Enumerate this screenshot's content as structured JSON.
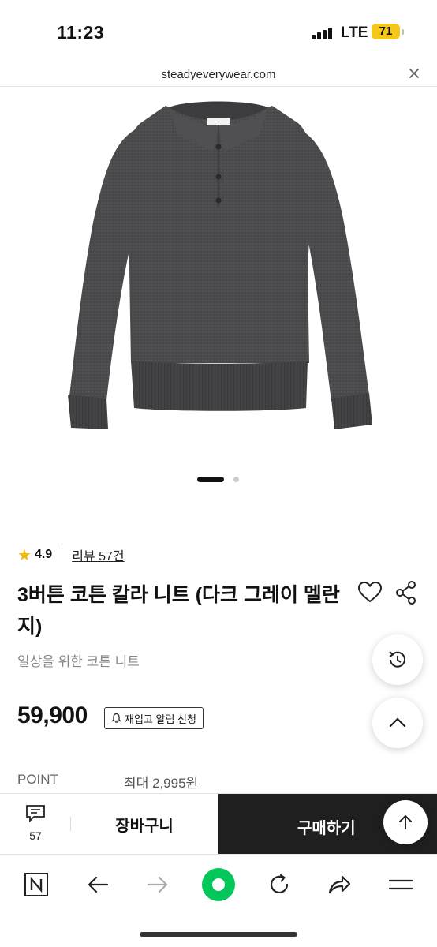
{
  "status_bar": {
    "time": "11:23",
    "network": "LTE",
    "battery": "71",
    "battery_color": "#f5c518"
  },
  "url_bar": {
    "url": "steadyeverywear.com",
    "close_icon": "close-icon"
  },
  "gallery": {
    "image": "dark gray polo knit sweater",
    "slide_count": 2,
    "active_slide": 1
  },
  "product": {
    "rating": "4.9",
    "review_label": "리뷰 57건",
    "title": "3버튼 코튼 칼라 니트 (다크 그레이 멜란지)",
    "subtitle": "일상을 위한 코튼 니트",
    "price": "59,900",
    "restock_label": "재입고 알림 신청",
    "point_label": "POINT",
    "point_value": "최대 2,995원"
  },
  "purchase_bar": {
    "chat_count": "57",
    "cart_label": "장바구니",
    "buy_label": "구매하기",
    "buy_color": "#1f1f1f"
  },
  "toolbar": {
    "items": [
      "naver-icon",
      "back-icon",
      "forward-icon",
      "home-icon",
      "refresh-icon",
      "share-icon",
      "menu-icon"
    ],
    "accent": "#03c75a"
  }
}
